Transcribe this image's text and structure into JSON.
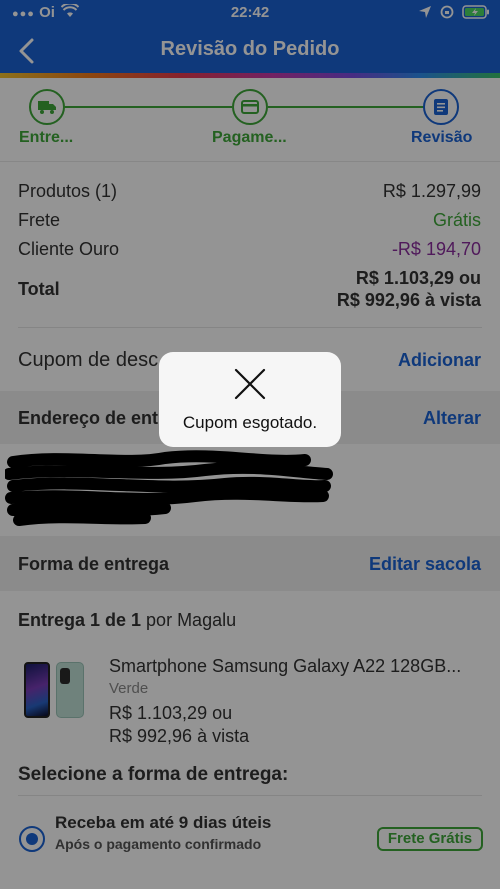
{
  "status_bar": {
    "carrier": "Oi",
    "time": "22:42"
  },
  "header": {
    "title": "Revisão do Pedido"
  },
  "stepper": {
    "steps": [
      {
        "label": "Entre...",
        "icon": "truck-icon"
      },
      {
        "label": "Pagame...",
        "icon": "card-icon"
      },
      {
        "label": "Revisão",
        "icon": "document-icon"
      }
    ]
  },
  "summary": {
    "products_label": "Produtos (1)",
    "products_value": "R$ 1.297,99",
    "shipping_label": "Frete",
    "shipping_value": "Grátis",
    "gold_label": "Cliente Ouro",
    "gold_value": "-R$ 194,70",
    "total_label": "Total",
    "total_line1": "R$ 1.103,29 ou",
    "total_line2": "R$ 992,96 à vista"
  },
  "coupon": {
    "label": "Cupom de desc",
    "action": "Adicionar"
  },
  "address": {
    "label": "Endereço de ent",
    "action": "Alterar"
  },
  "delivery_form": {
    "label": "Forma de entrega",
    "action": "Editar sacola"
  },
  "delivery": {
    "heading": "Entrega 1 de 1 por Magalu",
    "product_name": "Smartphone Samsung Galaxy A22 128GB...",
    "color": "Verde",
    "price_line1": "R$ 1.103,29 ou",
    "price_line2": "R$ 992,96 à vista"
  },
  "select_delivery": {
    "heading": "Selecione a forma de entrega:"
  },
  "option": {
    "title": "Receba em até 9 dias úteis",
    "subtitle": "Após o pagamento confirmado",
    "badge": "Frete Grátis"
  },
  "toast": {
    "message": "Cupom esgotado."
  },
  "colors": {
    "primary": "#1a62d4",
    "green": "#3fa83a",
    "purple": "#8a2d9e"
  }
}
